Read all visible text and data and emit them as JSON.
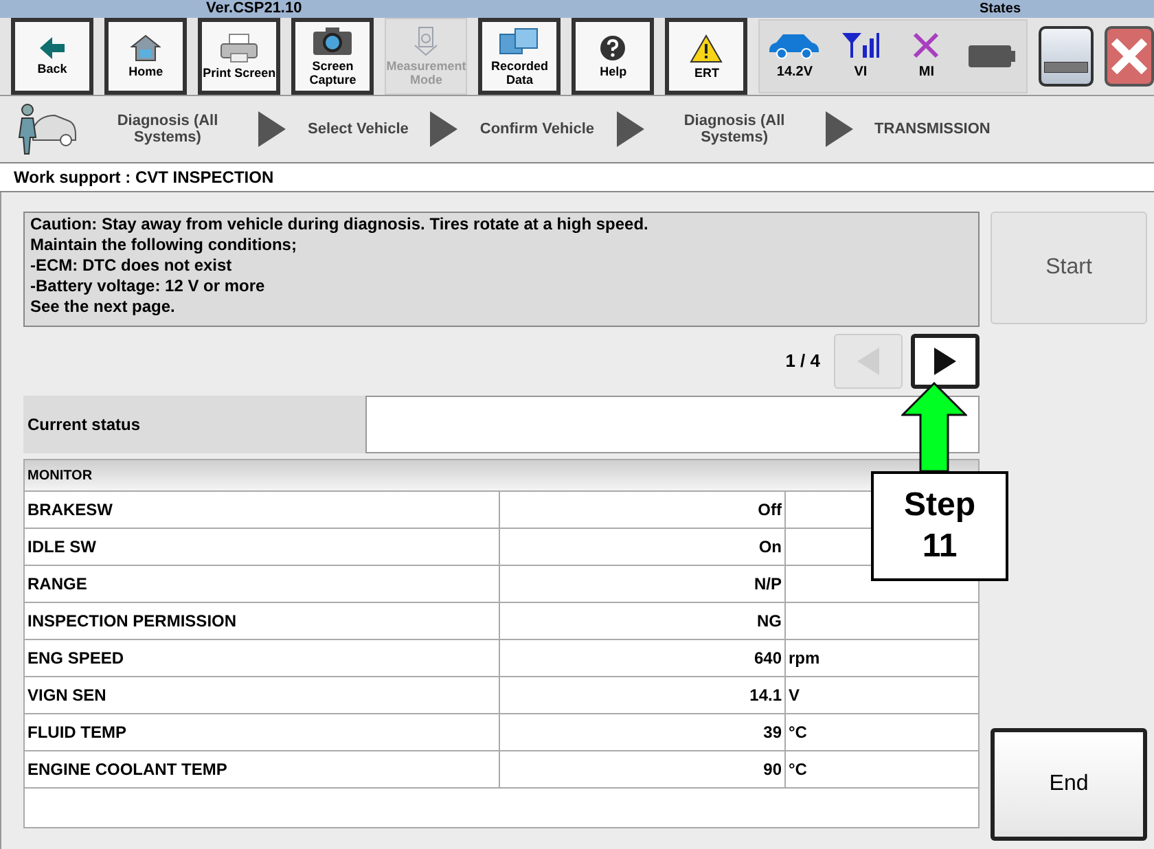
{
  "title_bar": {
    "version": "Ver.CSP21.10",
    "states_label": "States"
  },
  "toolbar": [
    {
      "label": "Back",
      "kind": "back",
      "disabled": false
    },
    {
      "label": "Home",
      "kind": "home",
      "disabled": false
    },
    {
      "label": "Print Screen",
      "kind": "print",
      "disabled": false
    },
    {
      "label": "Screen Capture",
      "kind": "camera",
      "disabled": false
    },
    {
      "label": "Measurement Mode",
      "kind": "meter",
      "disabled": true
    },
    {
      "label": "Recorded Data",
      "kind": "folder",
      "disabled": false
    },
    {
      "label": "Help",
      "kind": "help",
      "disabled": false
    },
    {
      "label": "ERT",
      "kind": "warning",
      "disabled": false
    }
  ],
  "status": [
    {
      "label": "14.2V",
      "kind": "car"
    },
    {
      "label": "VI",
      "kind": "signal"
    },
    {
      "label": "MI",
      "kind": "cross"
    },
    {
      "kind": "battery"
    }
  ],
  "breadcrumbs": [
    "Diagnosis (All Systems)",
    "Select Vehicle",
    "Confirm Vehicle",
    "Diagnosis (All Systems)",
    "TRANSMISSION"
  ],
  "heading": "Work support : CVT INSPECTION",
  "message": [
    "Caution: Stay away from vehicle during diagnosis. Tires rotate at a high speed.",
    "Maintain the following conditions;",
    "-ECM: DTC does not exist",
    "-Battery voltage: 12 V or more",
    "See the next page."
  ],
  "start_button": {
    "label": "Start",
    "disabled": true
  },
  "pager": {
    "page": "1 / 4",
    "prev_disabled": true,
    "next_disabled": false
  },
  "current_status": {
    "label": "Current status"
  },
  "monitor": {
    "header": "MONITOR",
    "rows": [
      {
        "name": "BRAKESW",
        "value": "Off"
      },
      {
        "name": "IDLE SW",
        "value": "On"
      },
      {
        "name": "RANGE",
        "value": "N/P"
      },
      {
        "name": "INSPECTION PERMISSION",
        "value": "NG"
      },
      {
        "name": "ENG SPEED",
        "value": "640",
        "unit": "rpm"
      },
      {
        "name": "VIGN SEN",
        "value": "14.1",
        "unit": "V"
      },
      {
        "name": "FLUID TEMP",
        "value": "39",
        "unit": "°C"
      },
      {
        "name": "ENGINE COOLANT TEMP",
        "value": "90",
        "unit": "°C"
      }
    ]
  },
  "end_button": {
    "label": "End"
  },
  "callout": {
    "label": "Step 11"
  }
}
